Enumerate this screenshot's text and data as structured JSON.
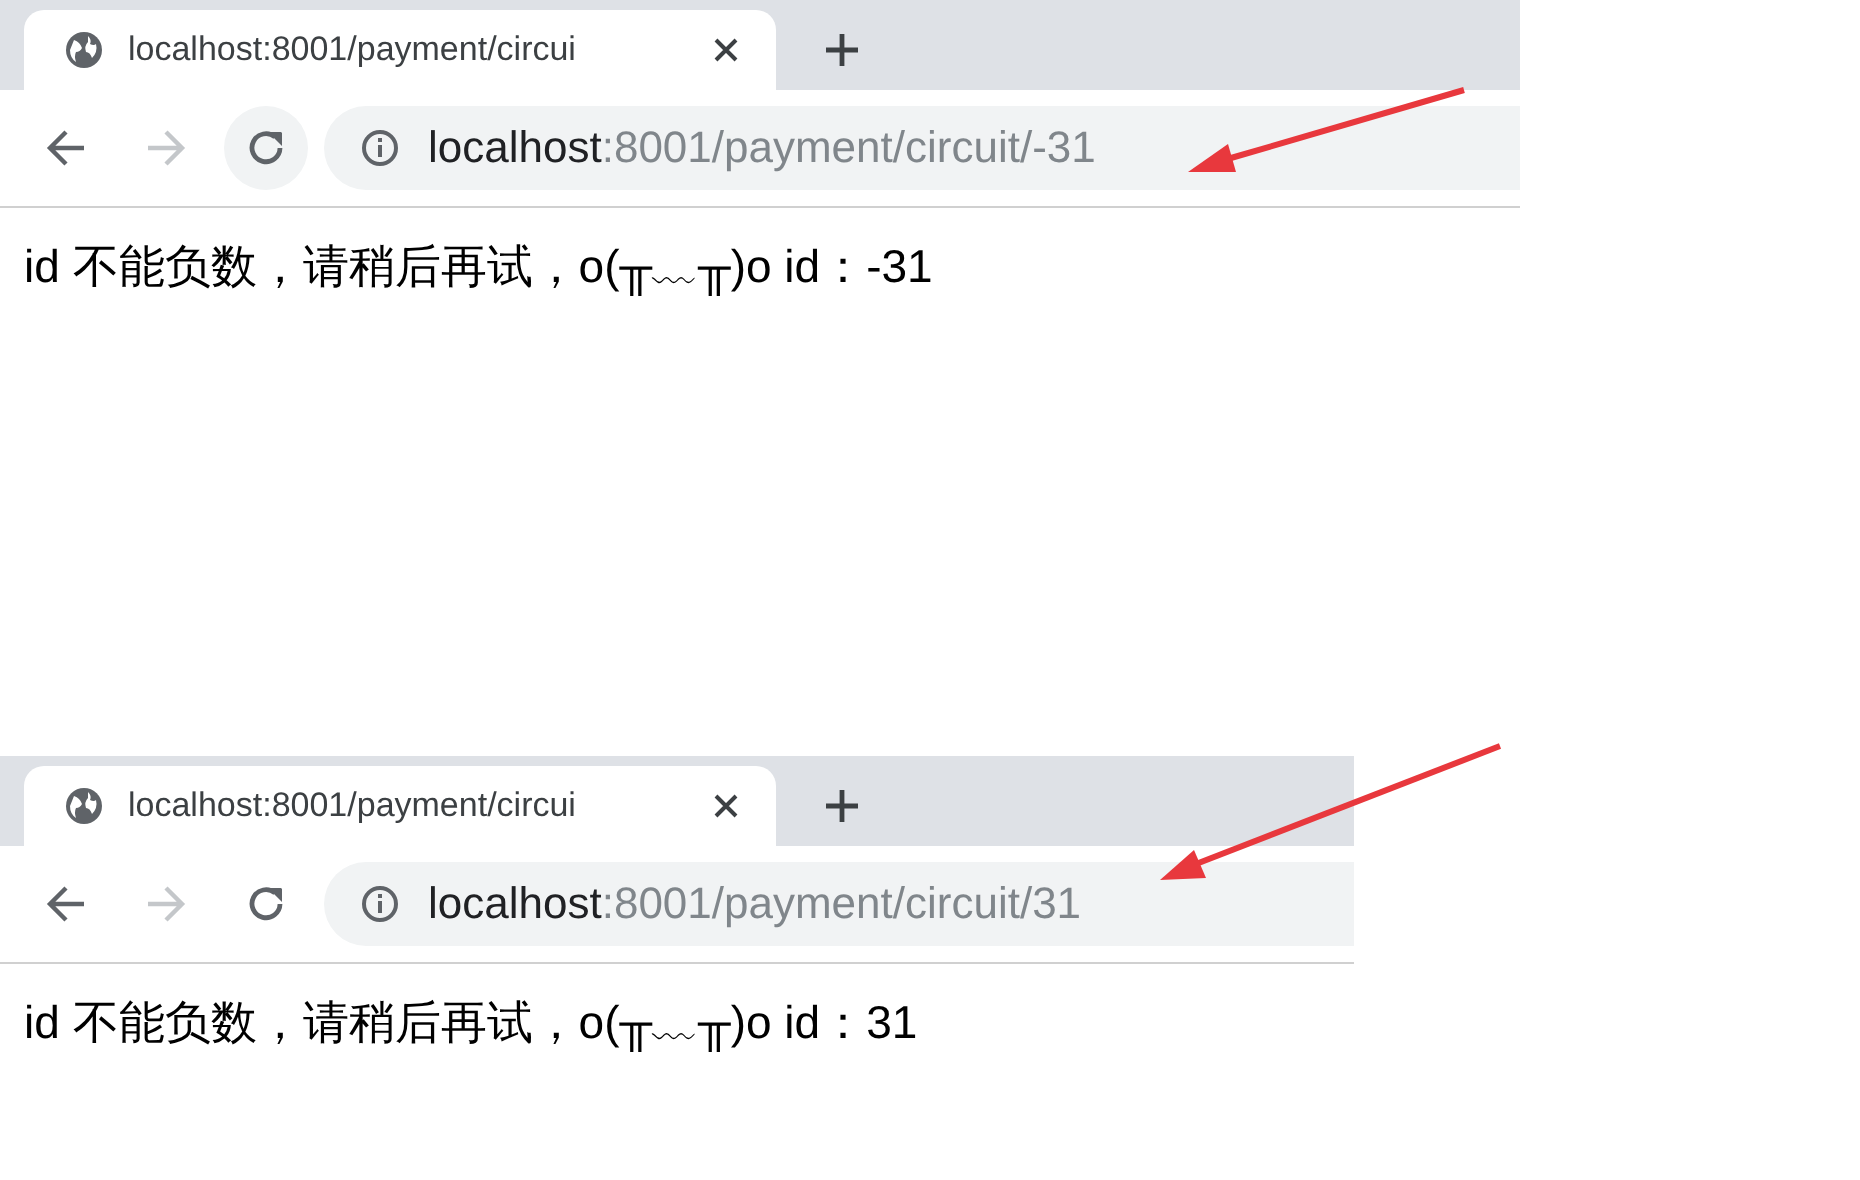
{
  "windows": [
    {
      "tab": {
        "title": "localhost:8001/payment/circui",
        "selected": true
      },
      "address": {
        "host": "localhost",
        "path": ":8001/payment/circuit/-31"
      },
      "forward_disabled": true,
      "body": "id 不能负数，请稍后再试，o(╥﹏╥)o id：-31"
    },
    {
      "tab": {
        "title": "localhost:8001/payment/circui",
        "selected": true
      },
      "address": {
        "host": "localhost",
        "path": ":8001/payment/circuit/31"
      },
      "forward_disabled": true,
      "body": "id 不能负数，请稍后再试，o(╥﹏╥)o id：31"
    }
  ]
}
